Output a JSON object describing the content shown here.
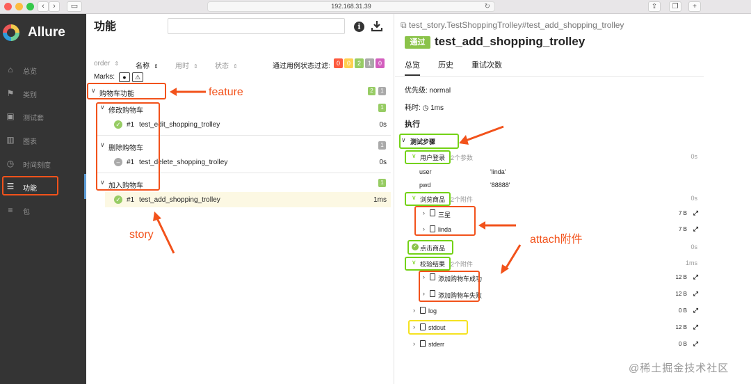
{
  "browser": {
    "url": "192.168.31.39",
    "back_icon": "chevron-left-icon",
    "forward_icon": "chevron-right-icon"
  },
  "sidebar": {
    "brand": "Allure",
    "items": [
      {
        "label": "总览",
        "icon": "home-icon"
      },
      {
        "label": "类别",
        "icon": "flag-icon"
      },
      {
        "label": "测试套",
        "icon": "briefcase-icon"
      },
      {
        "label": "图表",
        "icon": "bar-chart-icon"
      },
      {
        "label": "时间刻度",
        "icon": "clock-icon"
      },
      {
        "label": "功能",
        "icon": "list-icon"
      },
      {
        "label": "包",
        "icon": "stack-icon"
      }
    ]
  },
  "center": {
    "title": "功能",
    "columns": {
      "order": "order",
      "name": "名称",
      "duration": "用时",
      "status": "状态"
    },
    "filter_label": "通过用例状态过滤:",
    "filter_counts": [
      {
        "value": "0",
        "color": "#fd5a3e"
      },
      {
        "value": "0",
        "color": "#ffd050"
      },
      {
        "value": "2",
        "color": "#97cc64"
      },
      {
        "value": "1",
        "color": "#aaaaaa"
      },
      {
        "value": "0",
        "color": "#d35ebe"
      }
    ],
    "marks_label": "Marks:",
    "tree": {
      "feature": {
        "label": "购物车功能",
        "count_passed": "2",
        "count_skipped": "1"
      },
      "stories": [
        {
          "label": "修改购物车",
          "count": "1",
          "count_color": "#97cc64",
          "test": {
            "num": "#1",
            "name": "test_edit_shopping_trolley",
            "duration": "0s",
            "status": "passed"
          }
        },
        {
          "label": "删除购物车",
          "count": "1",
          "count_color": "#aaaaaa",
          "test": {
            "num": "#1",
            "name": "test_delete_shopping_trolley",
            "duration": "0s",
            "status": "skipped"
          }
        },
        {
          "label": "加入购物车",
          "count": "1",
          "count_color": "#97cc64",
          "test": {
            "num": "#1",
            "name": "test_add_shopping_trolley",
            "duration": "1ms",
            "status": "passed"
          }
        }
      ]
    }
  },
  "annotations": {
    "feature": "feature",
    "story": "story",
    "attach": "attach附件"
  },
  "detail": {
    "path": "test_story.TestShoppingTrolley#test_add_shopping_trolley",
    "status": "通过",
    "title": "test_add_shopping_trolley",
    "tabs": [
      "总览",
      "历史",
      "重试次数"
    ],
    "severity": "优先级: normal",
    "duration_label": "耗时:",
    "duration_value": "1ms",
    "execution_heading": "执行",
    "steps_group": "测试步骤",
    "steps": [
      {
        "label": "用户登录",
        "meta": "2个参数",
        "duration": "0s"
      },
      {
        "label": "浏览商品",
        "meta": "2个附件",
        "duration": "0s"
      },
      {
        "label": "点击商品",
        "meta": "",
        "duration": "0s"
      },
      {
        "label": "校验结果",
        "meta": "2个附件",
        "duration": "1ms"
      }
    ],
    "params": [
      {
        "name": "user",
        "value": "'linda'"
      },
      {
        "name": "pwd",
        "value": "'88888'"
      }
    ],
    "browse_attachments": [
      {
        "name": "三星",
        "size": "7 B"
      },
      {
        "name": "linda",
        "size": "7 B"
      }
    ],
    "verify_attachments": [
      {
        "name": "添加购物车成功",
        "size": "12 B"
      },
      {
        "name": "添加购物车失败",
        "size": "12 B"
      }
    ],
    "outputs": [
      {
        "name": "log",
        "size": "0 B"
      },
      {
        "name": "stdout",
        "size": "12 B"
      },
      {
        "name": "stderr",
        "size": "0 B"
      }
    ]
  },
  "watermark": "@稀土掘金技术社区"
}
